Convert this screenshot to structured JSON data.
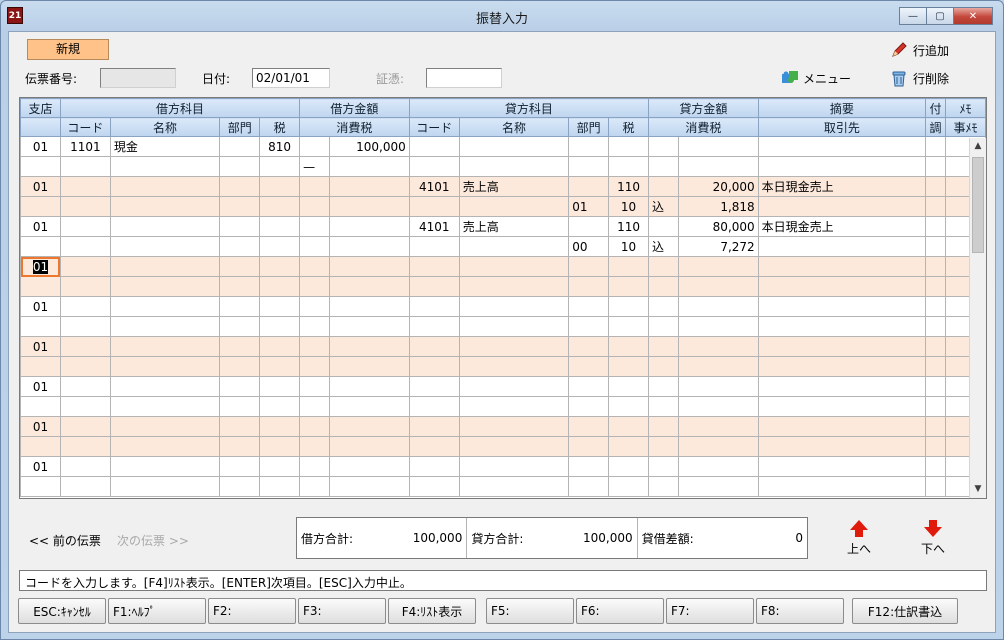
{
  "window": {
    "title": "振替入力",
    "app_logo": "21",
    "minimize": "—",
    "maximize": "▢",
    "close": "✕"
  },
  "header": {
    "new_badge": "新規",
    "voucher_no_label": "伝票番号:",
    "voucher_no_value": "",
    "date_label": "日付:",
    "date_value": "02/01/01",
    "proof_label": "証憑:",
    "proof_value": "",
    "add_row": "行追加",
    "menu": "メニュー",
    "delete_row": "行削除"
  },
  "grid": {
    "header1": [
      "支店",
      "借方科目",
      "借方金額",
      "貸方科目",
      "貸方金額",
      "摘要",
      "付",
      "ﾒﾓ"
    ],
    "header2": [
      "コード",
      "名称",
      "部門",
      "税",
      "消費税",
      "コード",
      "名称",
      "部門",
      "税",
      "消費税",
      "取引先",
      "調",
      "事ﾒﾓ"
    ],
    "rows": [
      [
        "01",
        "1101",
        "現金",
        "",
        "810",
        "",
        "100,000",
        "",
        "",
        "",
        "",
        "",
        "",
        "",
        "",
        ""
      ],
      [
        "",
        "",
        "",
        "",
        "",
        "—",
        "",
        "",
        "",
        "",
        "",
        "",
        "",
        "",
        "",
        ""
      ],
      [
        "01",
        "",
        "",
        "",
        "",
        "",
        "",
        "4101",
        "売上高",
        "",
        "110",
        "",
        "20,000",
        "本日現金売上",
        "",
        ""
      ],
      [
        "",
        "",
        "",
        "",
        "",
        "",
        "",
        "",
        "",
        "01",
        "10",
        "込",
        "1,818",
        "",
        "",
        ""
      ],
      [
        "01",
        "",
        "",
        "",
        "",
        "",
        "",
        "4101",
        "売上高",
        "",
        "110",
        "",
        "80,000",
        "本日現金売上",
        "",
        ""
      ],
      [
        "",
        "",
        "",
        "",
        "",
        "",
        "",
        "",
        "",
        "00",
        "10",
        "込",
        "7,272",
        "",
        "",
        ""
      ],
      [
        "01",
        "",
        "",
        "",
        "",
        "",
        "",
        "",
        "",
        "",
        "",
        "",
        "",
        "",
        "",
        ""
      ],
      [
        "",
        "",
        "",
        "",
        "",
        "",
        "",
        "",
        "",
        "",
        "",
        "",
        "",
        "",
        "",
        ""
      ],
      [
        "01",
        "",
        "",
        "",
        "",
        "",
        "",
        "",
        "",
        "",
        "",
        "",
        "",
        "",
        "",
        ""
      ],
      [
        "",
        "",
        "",
        "",
        "",
        "",
        "",
        "",
        "",
        "",
        "",
        "",
        "",
        "",
        "",
        ""
      ],
      [
        "01",
        "",
        "",
        "",
        "",
        "",
        "",
        "",
        "",
        "",
        "",
        "",
        "",
        "",
        "",
        ""
      ],
      [
        "",
        "",
        "",
        "",
        "",
        "",
        "",
        "",
        "",
        "",
        "",
        "",
        "",
        "",
        "",
        ""
      ],
      [
        "01",
        "",
        "",
        "",
        "",
        "",
        "",
        "",
        "",
        "",
        "",
        "",
        "",
        "",
        "",
        ""
      ],
      [
        "",
        "",
        "",
        "",
        "",
        "",
        "",
        "",
        "",
        "",
        "",
        "",
        "",
        "",
        "",
        ""
      ],
      [
        "01",
        "",
        "",
        "",
        "",
        "",
        "",
        "",
        "",
        "",
        "",
        "",
        "",
        "",
        "",
        ""
      ],
      [
        "",
        "",
        "",
        "",
        "",
        "",
        "",
        "",
        "",
        "",
        "",
        "",
        "",
        "",
        "",
        ""
      ],
      [
        "01",
        "",
        "",
        "",
        "",
        "",
        "",
        "",
        "",
        "",
        "",
        "",
        "",
        "",
        "",
        ""
      ],
      [
        "",
        "",
        "",
        "",
        "",
        "",
        "",
        "",
        "",
        "",
        "",
        "",
        "",
        "",
        "",
        ""
      ]
    ]
  },
  "footer": {
    "prev_voucher": "<< 前の伝票",
    "next_voucher": "次の伝票 >>",
    "debit_total_label": "借方合計:",
    "debit_total": "100,000",
    "credit_total_label": "貸方合計:",
    "credit_total": "100,000",
    "diff_label": "貸借差額:",
    "diff": "0",
    "up": "上へ",
    "down": "下へ",
    "status": "コードを入力します。[F4]ﾘｽﾄ表示。[ENTER]次項目。[ESC]入力中止。"
  },
  "fkeys": [
    "ESC:ｷｬﾝｾﾙ",
    "F1:ﾍﾙﾌﾟ",
    "F2:",
    "F3:",
    "F4:ﾘｽﾄ表示",
    "F5:",
    "F6:",
    "F7:",
    "F8:",
    "F12:仕訳書込"
  ],
  "colors": {
    "pink_row": "#fde9dc",
    "header_blue": "#bed5ef",
    "new_badge": "#ffc38a",
    "arrow_red": "#e11b0c"
  }
}
